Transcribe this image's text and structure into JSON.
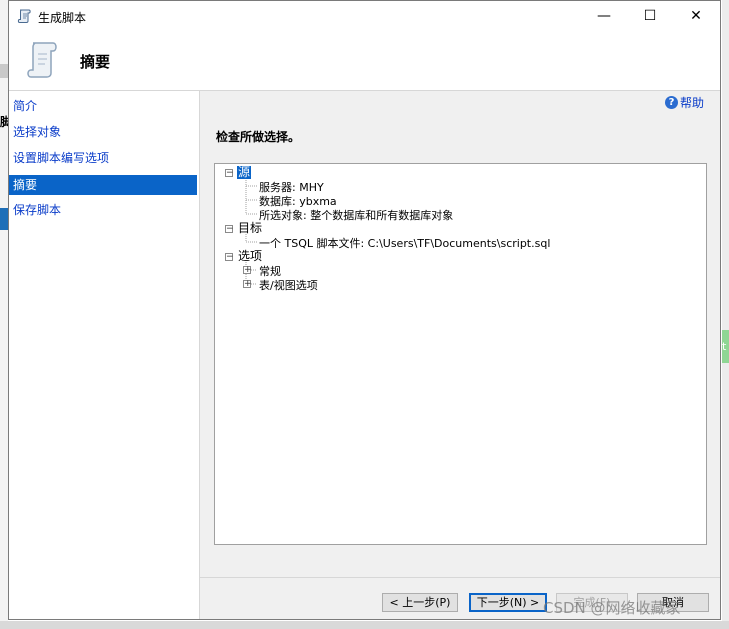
{
  "window": {
    "title": "生成脚本",
    "minimize_glyph": "—",
    "maximize_glyph": "☐",
    "close_glyph": "✕"
  },
  "header": {
    "title": "摘要"
  },
  "sidebar": {
    "items": [
      {
        "label": "简介",
        "active": false
      },
      {
        "label": "选择对象",
        "active": false
      },
      {
        "label": "设置脚本编写选项",
        "active": false
      },
      {
        "label": "摘要",
        "active": true
      },
      {
        "label": "保存脚本",
        "active": false
      }
    ]
  },
  "help": {
    "label": "帮助",
    "icon": "help-icon"
  },
  "main": {
    "heading": "检查所做选择。",
    "tree": {
      "source": {
        "label": "源",
        "children": [
          "服务器: MHY",
          "数据库: ybxma",
          "所选对象: 整个数据库和所有数据库对象"
        ]
      },
      "target": {
        "label": "目标",
        "children": [
          "一个 TSQL 脚本文件: C:\\Users\\TF\\Documents\\script.sql"
        ]
      },
      "options": {
        "label": "选项",
        "children": [
          "常规",
          "表/视图选项"
        ]
      },
      "collapse_glyph": "−",
      "expand_glyph": "+"
    }
  },
  "footer": {
    "prev_label": "< 上一步(P)",
    "next_label": "下一步(N) >",
    "finish_label": "完成(F)",
    "cancel_label": "取消"
  },
  "watermark": "CSDN @网络收藏家",
  "colors": {
    "selection": "#0a64c8",
    "link": "#0a3cc9"
  }
}
